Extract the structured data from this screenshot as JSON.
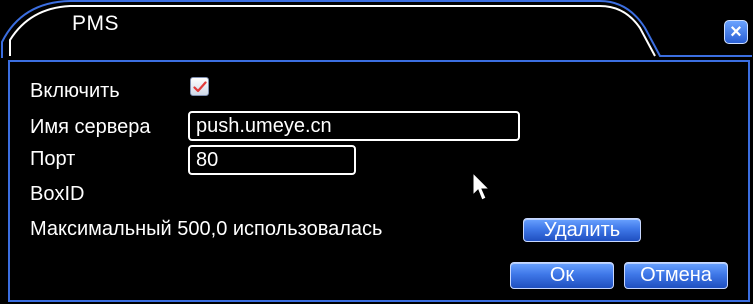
{
  "dialog": {
    "title": "PMS",
    "close_glyph": "×"
  },
  "form": {
    "enable_label": "Включить",
    "enable_checked": true,
    "server_label": "Имя сервера",
    "server_value": "push.umeye.cn",
    "port_label": "Порт",
    "port_value": "80",
    "boxid_label": "BoxID",
    "usage_text": "Максимальный 500,0 использовалась"
  },
  "buttons": {
    "delete_label": "Удалить",
    "ok_label": "Ок",
    "cancel_label": "Отмена"
  },
  "colors": {
    "accent": "#3b6ee0",
    "background": "#000000",
    "text": "#ffffff",
    "check": "#e23a3a"
  },
  "icons": {
    "close": "close-icon",
    "check": "checkmark-icon",
    "cursor": "mouse-cursor-icon"
  }
}
